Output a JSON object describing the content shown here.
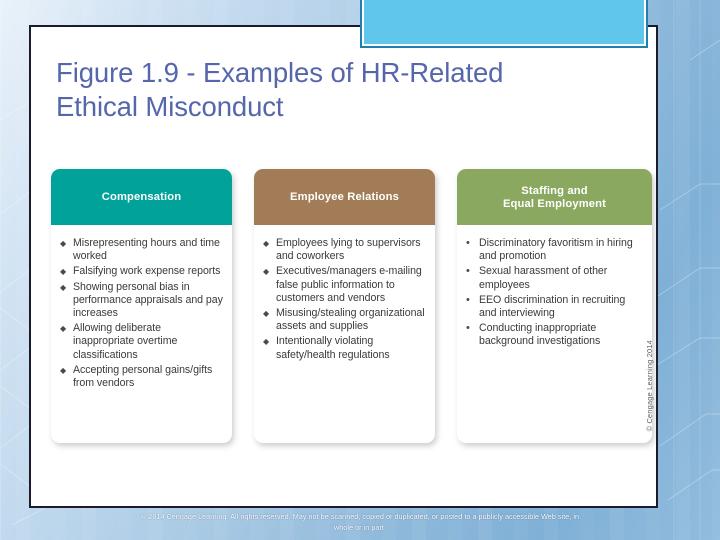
{
  "slide": {
    "title": "Figure 1.9 - Examples of HR-Related\nEthical Misconduct",
    "title_color": "#5566ad",
    "side_credit": "© Cengage Learning 2014",
    "footer": {
      "line1": "© 2014 Cengage Learning. All rights reserved. May not be scanned, copied or duplicated, or posted to a publicly accessible Web site, in",
      "line2": "whole or in part."
    }
  },
  "figure": {
    "columns": [
      {
        "header": "Compensation",
        "header_color": "#00a29a",
        "bullet_style": "diamond",
        "items": [
          "Misrepresenting hours and time worked",
          "Falsifying work expense reports",
          "Showing personal bias in performance appraisals and pay increases",
          "Allowing deliberate inappropriate overtime classifications",
          "Accepting personal gains/gifts from vendors"
        ]
      },
      {
        "header": "Employee Relations",
        "header_color": "#a17c56",
        "bullet_style": "diamond",
        "items": [
          "Employees lying to supervisors and coworkers",
          "Executives/managers e-mailing false public information to customers and vendors",
          "Misusing/stealing organizational assets and supplies",
          "Intentionally violating safety/health regulations"
        ]
      },
      {
        "header": "Staffing and\nEqual Employment",
        "header_color": "#8aa85f",
        "bullet_style": "round",
        "items": [
          "Discriminatory favoritism in hiring and promotion",
          "Sexual harassment of other employees",
          "EEO discrimination in recruiting and interviewing",
          "Conducting inappropriate background investigations"
        ]
      }
    ]
  },
  "decor": {
    "accent_rect_color": "#61c6ec",
    "panel_border_color": "#1b1b2d"
  }
}
